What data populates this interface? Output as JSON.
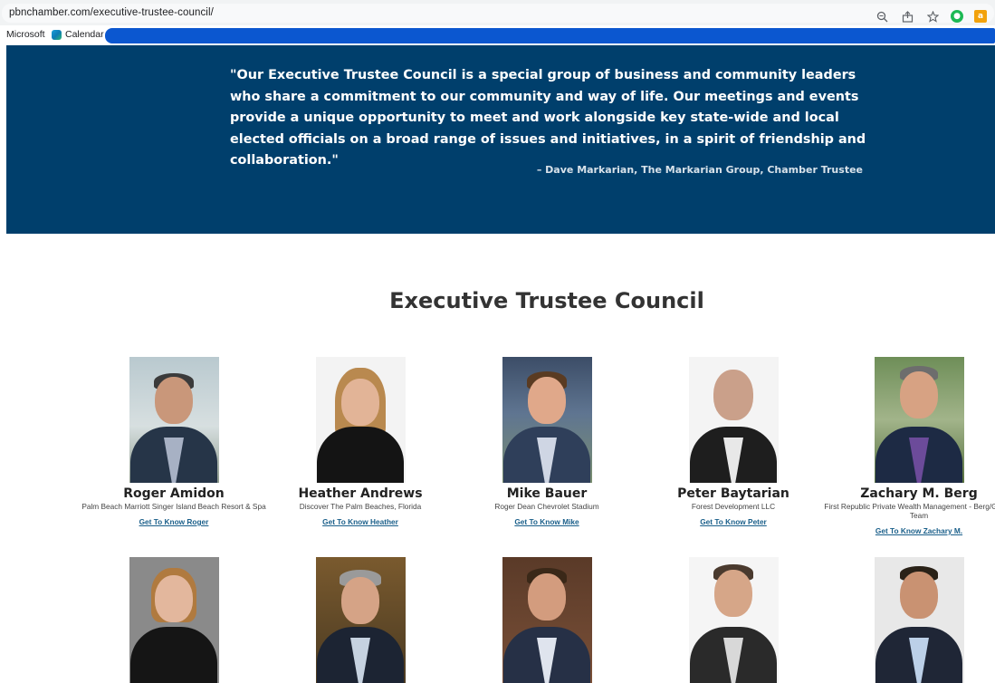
{
  "browser": {
    "url": "pbnchamber.com/executive-trustee-council/",
    "bookmarks": [
      {
        "label": "Microsoft"
      },
      {
        "label": "Calendar"
      }
    ],
    "icons": [
      "zoom-icon",
      "share-icon",
      "star-icon",
      "extension-green-icon",
      "extension-orange-icon"
    ]
  },
  "banner": {
    "quote": "\"Our Executive Trustee Council is a special group of business and community leaders who share a commitment to our community and way of life. Our meetings and events provide a unique opportunity to meet and work alongside key state-wide and local elected officials on a broad range of issues and initiatives, in a spirit of friendship and collaboration.\"",
    "attribution": "– Dave Markarian, The Markarian Group, Chamber Trustee",
    "background_color": "#003f6c"
  },
  "section": {
    "title": "Executive Trustee Council"
  },
  "trustees": [
    {
      "name": "Roger Amidon",
      "company": "Palm Beach Marriott Singer Island Beach Resort & Spa",
      "link": "Get To Know Roger"
    },
    {
      "name": "Heather Andrews",
      "company": "Discover The Palm Beaches, Florida",
      "link": "Get To Know Heather"
    },
    {
      "name": "Mike Bauer",
      "company": "Roger Dean Chevrolet Stadium",
      "link": "Get To Know Mike"
    },
    {
      "name": "Peter Baytarian",
      "company": "Forest Development LLC",
      "link": "Get To Know Peter"
    },
    {
      "name": "Zachary M. Berg",
      "company": "First Republic Private Wealth Management - Berg/Gilbert Team",
      "link": "Get To Know Zachary M."
    }
  ],
  "colors": {
    "link": "#1a5f8a",
    "title": "#333333"
  }
}
